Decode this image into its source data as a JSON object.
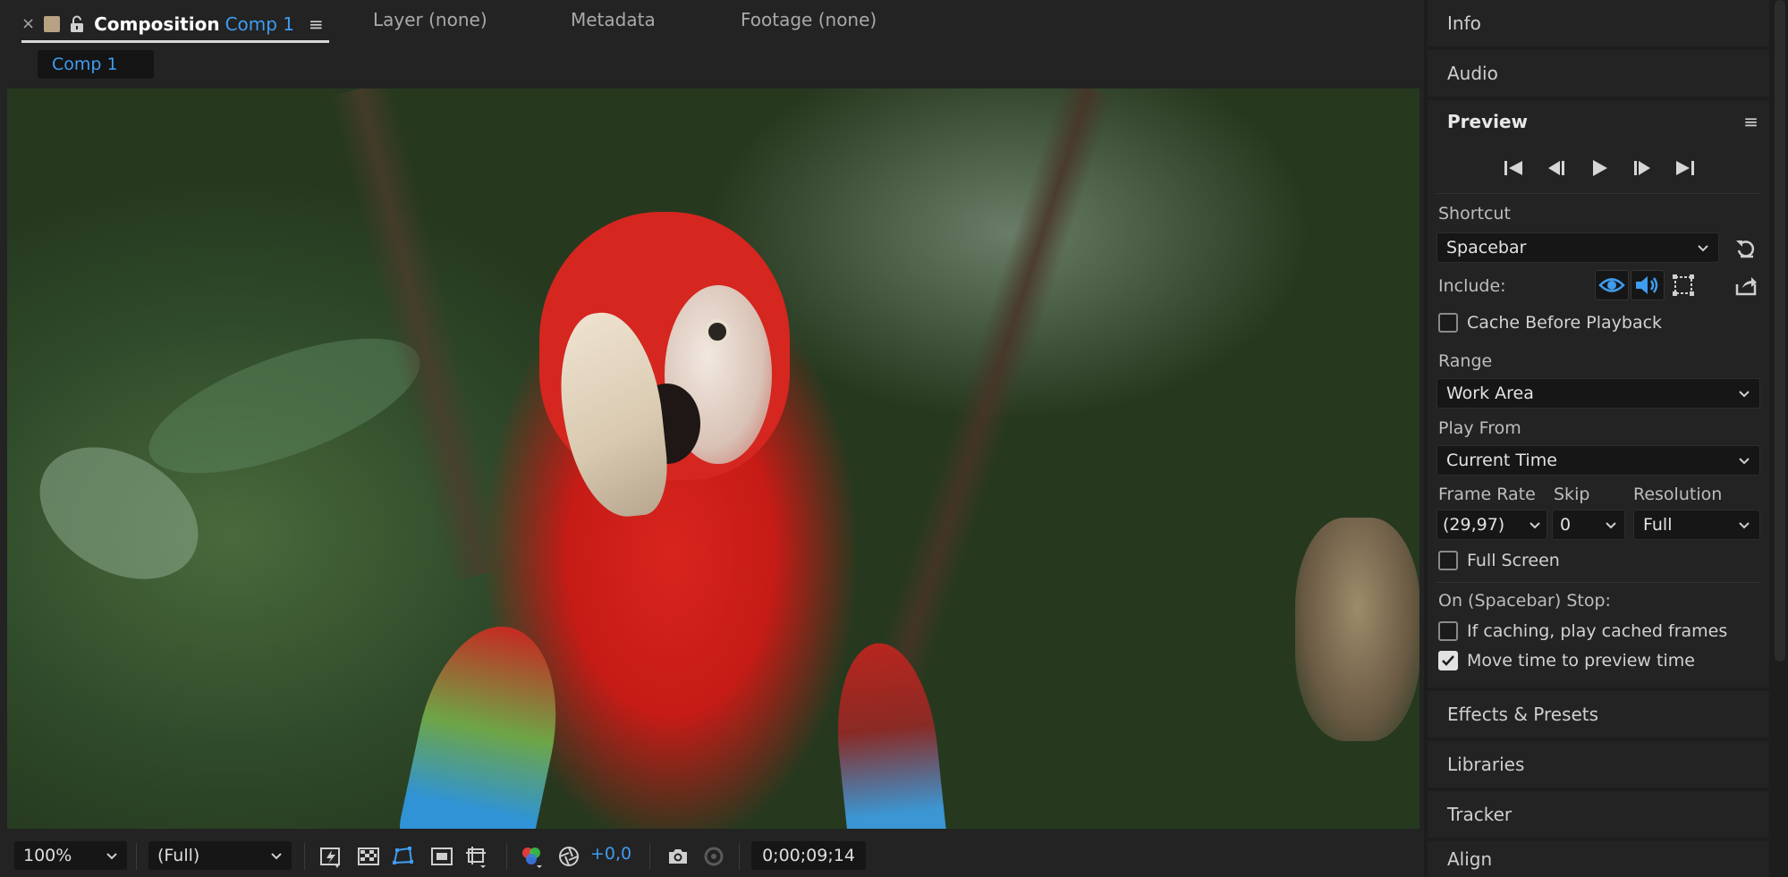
{
  "tabs": {
    "composition": {
      "close": "×",
      "label": "Composition",
      "comp": "Comp 1",
      "menu": "≡"
    },
    "layer": "Layer (none)",
    "metadata": "Metadata",
    "footage": "Footage (none)"
  },
  "breadcrumb": "Comp 1",
  "viewer_toolbar": {
    "zoom": "100%",
    "resolution": "(Full)",
    "exposure": "+0,0",
    "timecode": "0;00;09;14"
  },
  "panels": {
    "info": "Info",
    "audio": "Audio",
    "effects": "Effects & Presets",
    "libraries": "Libraries",
    "tracker": "Tracker",
    "align": "Align"
  },
  "preview": {
    "title": "Preview",
    "menu": "≡",
    "shortcut_label": "Shortcut",
    "shortcut_value": "Spacebar",
    "include_label": "Include:",
    "cache_before_playback": {
      "label": "Cache Before Playback",
      "checked": false
    },
    "range_label": "Range",
    "range_value": "Work Area",
    "play_from_label": "Play From",
    "play_from_value": "Current Time",
    "frame_rate_label": "Frame Rate",
    "frame_rate_value": "(29,97)",
    "skip_label": "Skip",
    "skip_value": "0",
    "resolution_label": "Resolution",
    "resolution_value": "Full",
    "full_screen": {
      "label": "Full Screen",
      "checked": false
    },
    "on_stop_label": "On (Spacebar) Stop:",
    "if_caching": {
      "label": "If caching, play cached frames",
      "checked": false
    },
    "move_time": {
      "label": "Move time to preview time",
      "checked": true
    }
  },
  "colors": {
    "accent_blue": "#3f9cf0",
    "panel_bg": "#232323",
    "app_bg": "#1d1d1d",
    "label_swatch": "#b9a283"
  }
}
